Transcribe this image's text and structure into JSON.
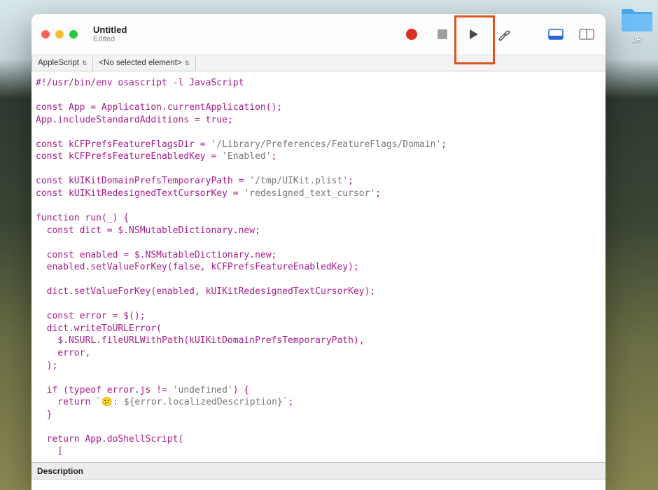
{
  "desktop": {
    "folder_label": "JR"
  },
  "window": {
    "title": "Untitled",
    "subtitle": "Edited"
  },
  "navbar": {
    "language": "AppleScript",
    "element": "<No selected element>"
  },
  "code": {
    "text": "#!/usr/bin/env osascript -l JavaScript\n\nconst App = Application.currentApplication();\nApp.includeStandardAdditions = true;\n\nconst kCFPrefsFeatureFlagsDir = '/Library/Preferences/FeatureFlags/Domain';\nconst kCFPrefsFeatureEnabledKey = 'Enabled';\n\nconst kUIKitDomainPrefsTemporaryPath = '/tmp/UIKit.plist';\nconst kUIKitRedesignedTextCursorKey = 'redesigned_text_cursor';\n\nfunction run(_) {\n  const dict = $.NSMutableDictionary.new;\n\n  const enabled = $.NSMutableDictionary.new;\n  enabled.setValueForKey(false, kCFPrefsFeatureEnabledKey);\n\n  dict.setValueForKey(enabled, kUIKitRedesignedTextCursorKey);\n\n  const error = $();\n  dict.writeToURLError(\n    $.NSURL.fileURLWithPath(kUIKitDomainPrefsTemporaryPath),\n    error,\n  );\n\n  if (typeof error.js != 'undefined') {\n    return `😕: ${error.localizedDescription}`;\n  }\n\n  return App.doShellScript(\n    ["
  },
  "panel": {
    "description_label": "Description"
  }
}
